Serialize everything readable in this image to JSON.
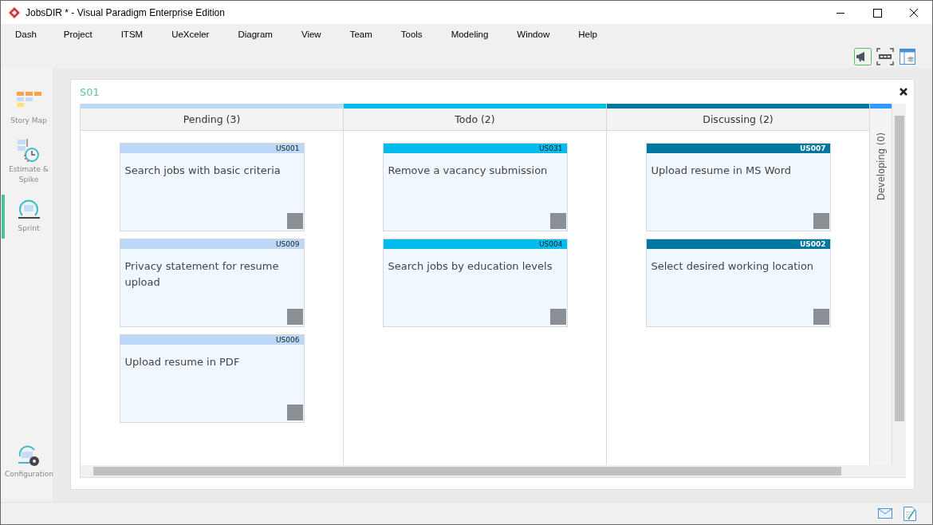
{
  "window": {
    "title": "JobsDIR * - Visual Paradigm Enterprise Edition"
  },
  "menu": [
    "Dash",
    "Project",
    "ITSM",
    "UeXceler",
    "Diagram",
    "View",
    "Team",
    "Tools",
    "Modeling",
    "Window",
    "Help"
  ],
  "sidebar": {
    "items": [
      {
        "label": "Story Map",
        "kind": "storymap",
        "selected": false
      },
      {
        "label": "Estimate & Spike",
        "kind": "estimate",
        "selected": false
      },
      {
        "label": "Sprint",
        "kind": "sprint",
        "selected": true
      }
    ],
    "footer": {
      "label": "Configuration"
    }
  },
  "sprint": {
    "title": "S01",
    "columns": [
      {
        "title": "Pending (3)",
        "color": "#bcd8f8",
        "cards": [
          {
            "id": "US001",
            "text": "Search jobs with basic criteria"
          },
          {
            "id": "US009",
            "text": "Privacy statement for resume upload"
          },
          {
            "id": "US006",
            "text": "Upload resume in PDF"
          }
        ]
      },
      {
        "title": "Todo (2)",
        "color": "#00bcec",
        "cards": [
          {
            "id": "US031",
            "text": "Remove a vacancy submission"
          },
          {
            "id": "US004",
            "text": "Search jobs by education levels"
          }
        ]
      },
      {
        "title": "Discussing (2)",
        "color": "#00779e",
        "cards": [
          {
            "id": "US007",
            "text": "Upload resume in MS Word"
          },
          {
            "id": "US002",
            "text": "Select desired working location"
          }
        ]
      }
    ],
    "collapsed_column": {
      "title": "Developing (0)",
      "color": "#3399ff"
    }
  }
}
